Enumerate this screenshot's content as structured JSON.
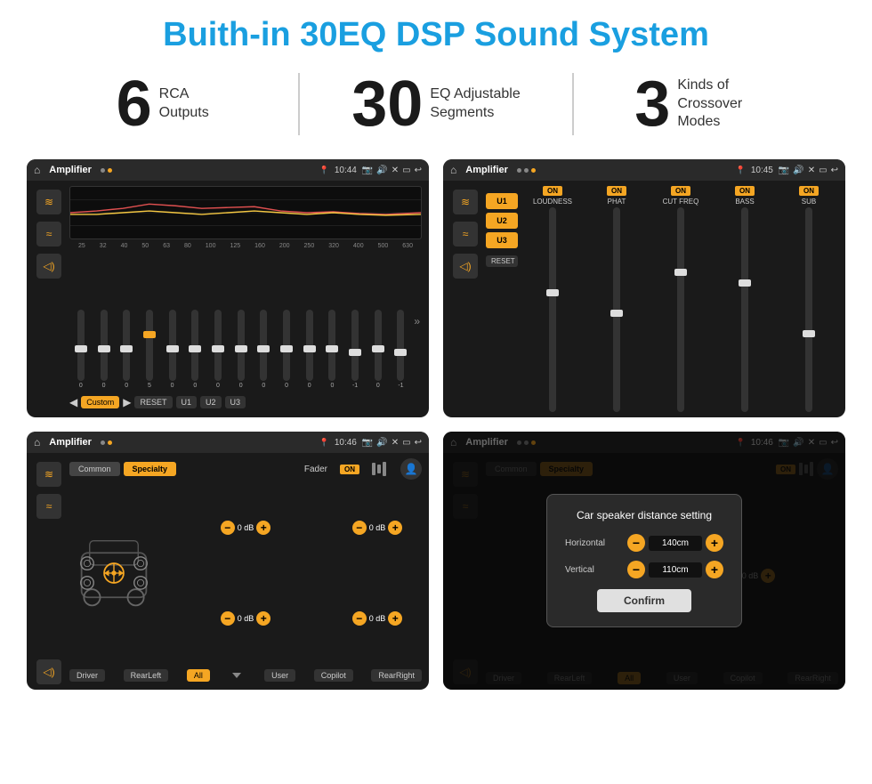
{
  "header": {
    "title": "Buith-in 30EQ DSP Sound System"
  },
  "stats": [
    {
      "number": "6",
      "label": "RCA\nOutputs"
    },
    {
      "number": "30",
      "label": "EQ Adjustable\nSegments"
    },
    {
      "number": "3",
      "label": "Kinds of\nCrossover Modes"
    }
  ],
  "screens": [
    {
      "id": "screen1",
      "status_bar": {
        "title": "Amplifier",
        "time": "10:44"
      },
      "type": "eq",
      "eq_labels": [
        "25",
        "32",
        "40",
        "50",
        "63",
        "80",
        "100",
        "125",
        "160",
        "200",
        "250",
        "320",
        "400",
        "500",
        "630"
      ],
      "eq_values": [
        "0",
        "0",
        "0",
        "5",
        "0",
        "0",
        "0",
        "0",
        "0",
        "0",
        "0",
        "0",
        "-1",
        "0",
        "-1"
      ],
      "buttons": [
        "Custom",
        "RESET",
        "U1",
        "U2",
        "U3"
      ]
    },
    {
      "id": "screen2",
      "status_bar": {
        "title": "Amplifier",
        "time": "10:45"
      },
      "type": "crossover",
      "presets": [
        "U1",
        "U2",
        "U3"
      ],
      "channels": [
        {
          "name": "LOUDNESS",
          "on": true
        },
        {
          "name": "PHAT",
          "on": true
        },
        {
          "name": "CUT FREQ",
          "on": true
        },
        {
          "name": "BASS",
          "on": true
        },
        {
          "name": "SUB",
          "on": true
        }
      ],
      "reset_label": "RESET"
    },
    {
      "id": "screen3",
      "status_bar": {
        "title": "Amplifier",
        "time": "10:46"
      },
      "type": "fader",
      "tabs": [
        "Common",
        "Specialty"
      ],
      "active_tab": "Specialty",
      "fader_label": "Fader",
      "on_label": "ON",
      "db_rows": [
        {
          "value": "0 dB"
        },
        {
          "value": "0 dB"
        },
        {
          "value": "0 dB"
        },
        {
          "value": "0 dB"
        }
      ],
      "zone_buttons": [
        "Driver",
        "RearLeft",
        "All",
        "User",
        "Copilot",
        "RearRight"
      ]
    },
    {
      "id": "screen4",
      "status_bar": {
        "title": "Amplifier",
        "time": "10:46"
      },
      "type": "distance",
      "modal": {
        "title": "Car speaker distance setting",
        "horizontal_label": "Horizontal",
        "horizontal_value": "140cm",
        "vertical_label": "Vertical",
        "vertical_value": "110cm",
        "confirm_label": "Confirm"
      },
      "tabs": [
        "Common",
        "Specialty"
      ],
      "active_tab": "Specialty",
      "on_label": "ON",
      "zone_buttons": [
        "Driver",
        "RearLeft",
        "All",
        "User",
        "Copilot",
        "RearRight"
      ]
    }
  ],
  "icons": {
    "home": "⌂",
    "back": "↩",
    "play": "▶",
    "pause": "⏸",
    "eq": "≋",
    "wave": "≈",
    "speaker": "◁",
    "settings": "⚙",
    "camera": "📷",
    "volume": "♪",
    "close": "✕",
    "window": "▭",
    "nav": "◁",
    "arrows": "»",
    "prev": "◀",
    "next": "▶",
    "minus": "−",
    "plus": "+"
  }
}
